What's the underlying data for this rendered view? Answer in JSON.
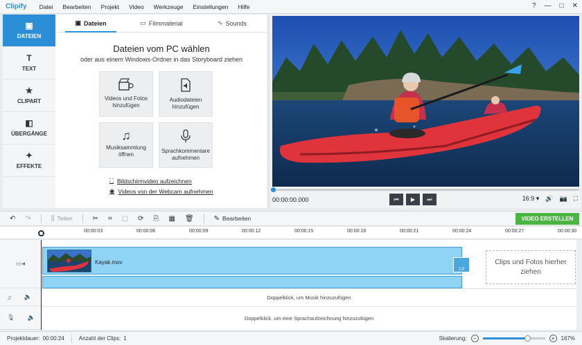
{
  "app": {
    "logo": "Clipify"
  },
  "menu": [
    "Datei",
    "Bearbeiten",
    "Projekt",
    "Video",
    "Werkzeuge",
    "Einstellungen",
    "Hilfe"
  ],
  "window_controls": [
    "?",
    "—",
    "□",
    "✕"
  ],
  "sidenav": [
    {
      "label": "DATEIEN",
      "icon": "image-icon",
      "glyph": "▣",
      "active": true
    },
    {
      "label": "TEXT",
      "icon": "text-icon",
      "glyph": "T",
      "active": false
    },
    {
      "label": "CLIPART",
      "icon": "star-icon",
      "glyph": "★",
      "active": false
    },
    {
      "label": "ÜBERGÄNGE",
      "icon": "transition-icon",
      "glyph": "◧",
      "active": false
    },
    {
      "label": "EFFEKTE",
      "icon": "wand-icon",
      "glyph": "✦",
      "active": false
    }
  ],
  "tabs": [
    {
      "label": "Dateien",
      "glyph": "▣",
      "active": true
    },
    {
      "label": "Filmmaterial",
      "glyph": "▭",
      "active": false
    },
    {
      "label": "Sounds",
      "glyph": "∿",
      "active": false
    }
  ],
  "panel": {
    "title": "Dateien vom PC wählen",
    "subtitle": "oder aus einem Windows-Ordner in das Storyboard ziehen",
    "tiles": [
      {
        "label": "Videos und Fotos hinzufügen",
        "icon": "film-camera-icon",
        "glyph": "🎬"
      },
      {
        "label": "Audiodateien hinzufügen",
        "icon": "audio-file-icon",
        "glyph": "🔊"
      },
      {
        "label": "Musiksammlung öffnen",
        "icon": "music-note-icon",
        "glyph": "♫"
      },
      {
        "label": "Sprachkommentare aufnehmen",
        "icon": "microphone-icon",
        "glyph": "🎙"
      }
    ],
    "links": [
      {
        "label": "Bildschirmvideo aufzeichnen",
        "glyph": "⛶"
      },
      {
        "label": "Videos von der Webcam aufnehmen",
        "glyph": "◉"
      }
    ]
  },
  "preview": {
    "timecode": "00:00:00.000",
    "aspect": "16:9 ▾",
    "controls": [
      "⏮",
      "▶",
      "⏭"
    ],
    "right_icons": [
      "🔊",
      "📷",
      "⛶"
    ]
  },
  "toolbar": {
    "undo": "↶",
    "redo": "↷",
    "split_label": "Teilen",
    "edit_label": "Bearbeiten",
    "create_label": "VIDEO ERSTELLEN",
    "tools": [
      "✂",
      "⌗",
      "▢",
      "⟳",
      "⎘",
      "▦",
      "🗑"
    ]
  },
  "ruler": [
    "00:00:03",
    "00:00:06",
    "00:00:09",
    "00:00:12",
    "00:00:15",
    "00:00:18",
    "00:00:21",
    "00:00:24",
    "00:00:27",
    "00:00:30"
  ],
  "timeline": {
    "clip_name": "Kayak.mov",
    "transition_value": "2.0",
    "drop_zone": "Clips und Fotos hierher ziehen",
    "music_hint": "Doppelklick, um Musik hinzuzufügen",
    "voice_hint": "Doppelklick, um eine Sprachaufzeichnung hinzuzufügen"
  },
  "status": {
    "duration_label": "Projektdauer:",
    "duration_value": "00:00:24",
    "clips_label": "Anzahl der Clips:",
    "clips_value": "1",
    "scale_label": "Skalierung:",
    "zoom_value": "167%",
    "zoom_fraction": 0.72
  },
  "colors": {
    "accent": "#2c8ed6",
    "create": "#4bb543",
    "clip": "#8fd3f5",
    "kayak": "#e0343d"
  }
}
